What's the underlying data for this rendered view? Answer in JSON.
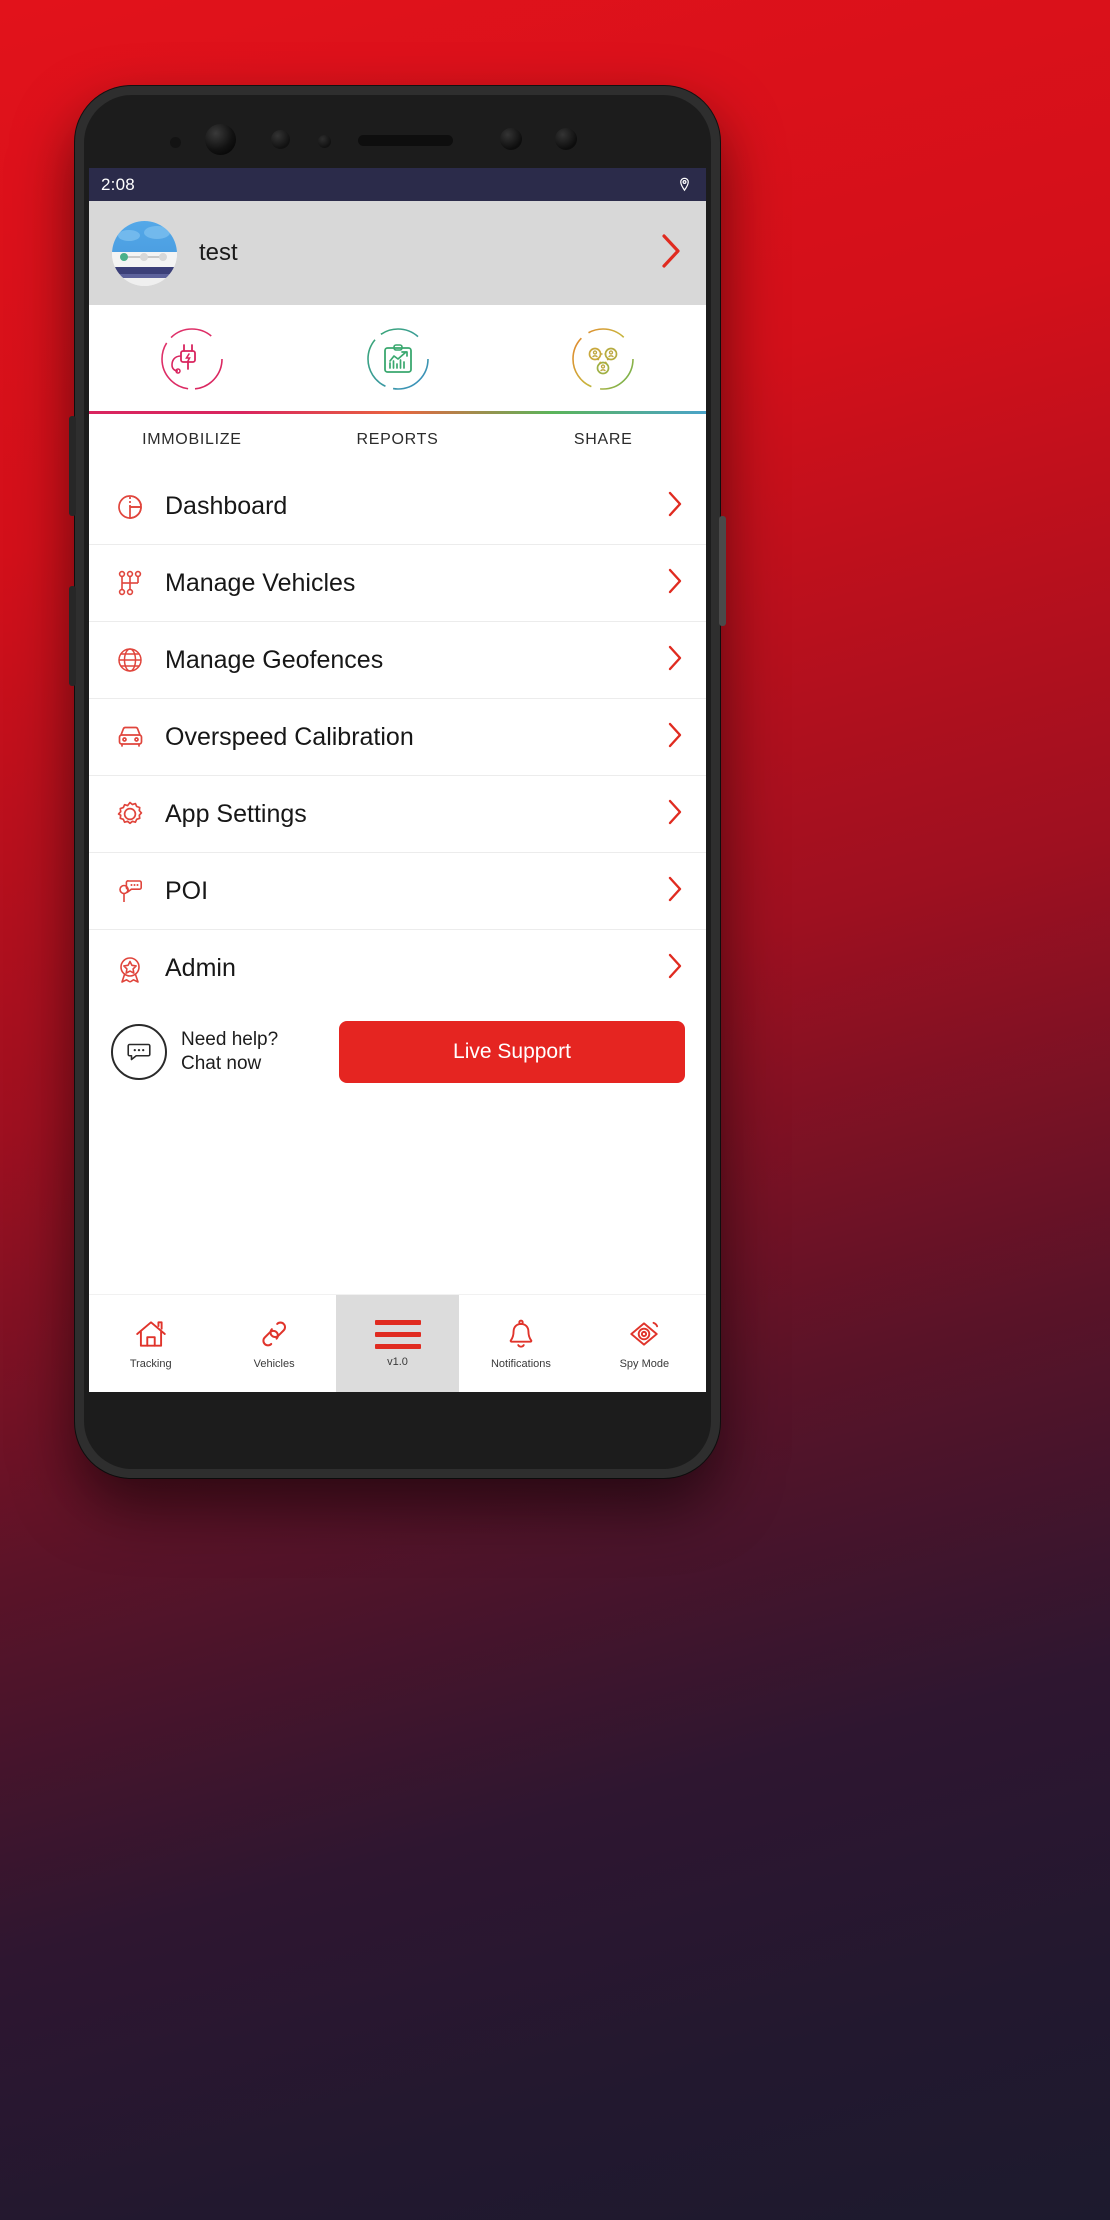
{
  "status_bar": {
    "time": "2:08",
    "icons": [
      "location-icon"
    ]
  },
  "profile": {
    "name": "test",
    "avatar_alt": "user-avatar",
    "chevron": "›"
  },
  "quick_actions": [
    {
      "label": "IMMOBILIZE",
      "icon": "plug-icon",
      "color": "#e0336b"
    },
    {
      "label": "REPORTS",
      "icon": "report-chart-icon",
      "color": "#3aa86f"
    },
    {
      "label": "SHARE",
      "icon": "share-network-icon",
      "color": "#c9b43c"
    }
  ],
  "underline_colors": [
    "#d9255f",
    "#e8643f",
    "#5bb45a",
    "#4aa3c9"
  ],
  "menu": {
    "items": [
      {
        "label": "Dashboard",
        "icon": "pie-chart-icon",
        "chevron": "›"
      },
      {
        "label": "Manage Vehicles",
        "icon": "gear-shift-icon",
        "chevron": "›"
      },
      {
        "label": "Manage Geofences",
        "icon": "globe-icon",
        "chevron": "›"
      },
      {
        "label": "Overspeed Calibration",
        "icon": "car-front-icon",
        "chevron": "›"
      },
      {
        "label": "App Settings",
        "icon": "gear-icon",
        "chevron": "›"
      },
      {
        "label": "POI",
        "icon": "map-pin-message-icon",
        "chevron": "›"
      },
      {
        "label": "Admin",
        "icon": "award-badge-icon",
        "chevron": "›"
      }
    ]
  },
  "support": {
    "text": "Need help? Chat now",
    "icon": "chat-bubble-icon",
    "button_label": "Live Support",
    "button_color": "#e52521"
  },
  "bottom_nav": {
    "items": [
      {
        "label": "Tracking",
        "icon": "home-icon",
        "active": false
      },
      {
        "label": "Vehicles",
        "icon": "link-chain-icon",
        "active": false
      },
      {
        "label": "v1.0",
        "icon": "hamburger-menu-icon",
        "active": true
      },
      {
        "label": "Notifications",
        "icon": "bell-icon",
        "active": false
      },
      {
        "label": "Spy Mode",
        "icon": "eye-icon",
        "active": false
      }
    ]
  },
  "theme": {
    "accent": "#e02b20",
    "statusbar_bg": "#2b2b4a",
    "profile_bg": "#d8d8d8"
  }
}
